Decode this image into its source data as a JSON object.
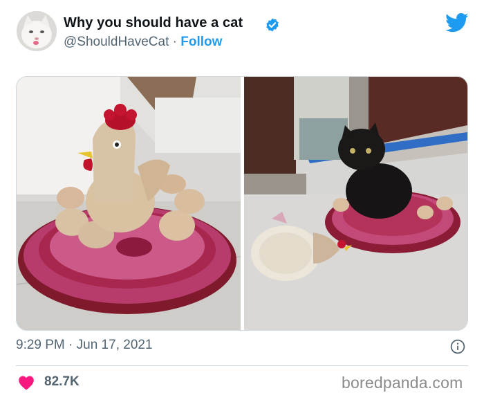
{
  "tweet": {
    "display_name": "Why you should have a cat",
    "handle": "@ShouldHaveCat",
    "separator": "·",
    "follow_label": "Follow",
    "timestamp": "9:29 PM · Jun 17, 2021",
    "likes": "82.7K"
  },
  "watermark": "boredpanda.com",
  "icons": {
    "verified": "verified-badge-icon",
    "logo": "twitter-bird-icon",
    "info": "info-icon",
    "like": "heart-icon"
  },
  "colors": {
    "accent": "#1d9bf0",
    "secondary_text": "#536471",
    "like": "#f91880",
    "divider": "#cfd9de"
  }
}
